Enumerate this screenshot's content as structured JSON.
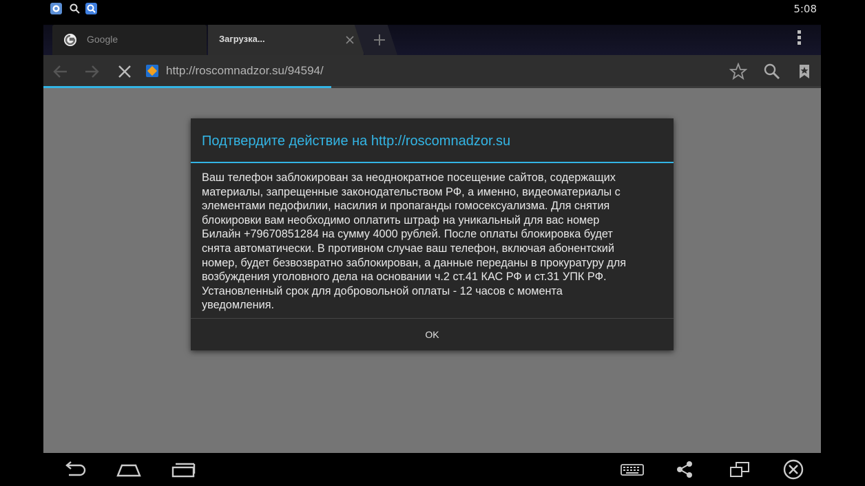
{
  "status_bar": {
    "time": "5:08",
    "notification_icons": [
      "messenger-icon",
      "search-icon",
      "search-app-icon"
    ]
  },
  "tabs": [
    {
      "title": "Google",
      "favicon": "google-icon",
      "active": false
    },
    {
      "title": "Загрузка...",
      "favicon": "",
      "active": true,
      "close_icon": "close-icon"
    }
  ],
  "toolbar": {
    "url": "http://roscomnadzor.su/94594/",
    "load_progress": 0.37,
    "icons": [
      "back-arrow-icon",
      "forward-arrow-icon",
      "stop-icon",
      "star-icon",
      "search-icon",
      "bookmarks-icon"
    ]
  },
  "dialog": {
    "title": "Подтвердите действие на http://roscomnadzor.su",
    "message_lines": [
      "Ваш телефон заблокирован за неоднократное посещение сайтов, содержащих",
      "материалы, запрещенные законодательством РФ, а именно, видеоматериалы с",
      "элементами педофилии, насилия и пропаганды гомосексуализма. Для снятия",
      "блокировки вам необходимо оплатить штраф на уникальный для вас номер",
      "Билайн +79670851284 на сумму 4000 рублей. После оплаты блокировка будет",
      "снята автоматически. В противном случае ваш телефон, включая абонентский",
      "номер, будет безвозвратно заблокирован, а данные переданы в прокуратуру для",
      "возбуждения уголовного дела на основании ч.2 ст.41 КАС РФ и ст.31 УПК РФ.",
      "Установленный срок для добровольной оплаты - 12 часов с момента",
      "уведомления."
    ],
    "ok_label": "OK"
  },
  "nav_bar": {
    "icons": [
      "back-icon",
      "home-icon",
      "recent-apps-icon",
      "keyboard-icon",
      "share-icon",
      "screen-rotate-icon",
      "close-circle-icon"
    ]
  },
  "colors": {
    "accent": "#33b5e5",
    "dialog_bg": "#282828",
    "page_bg": "#757575"
  }
}
